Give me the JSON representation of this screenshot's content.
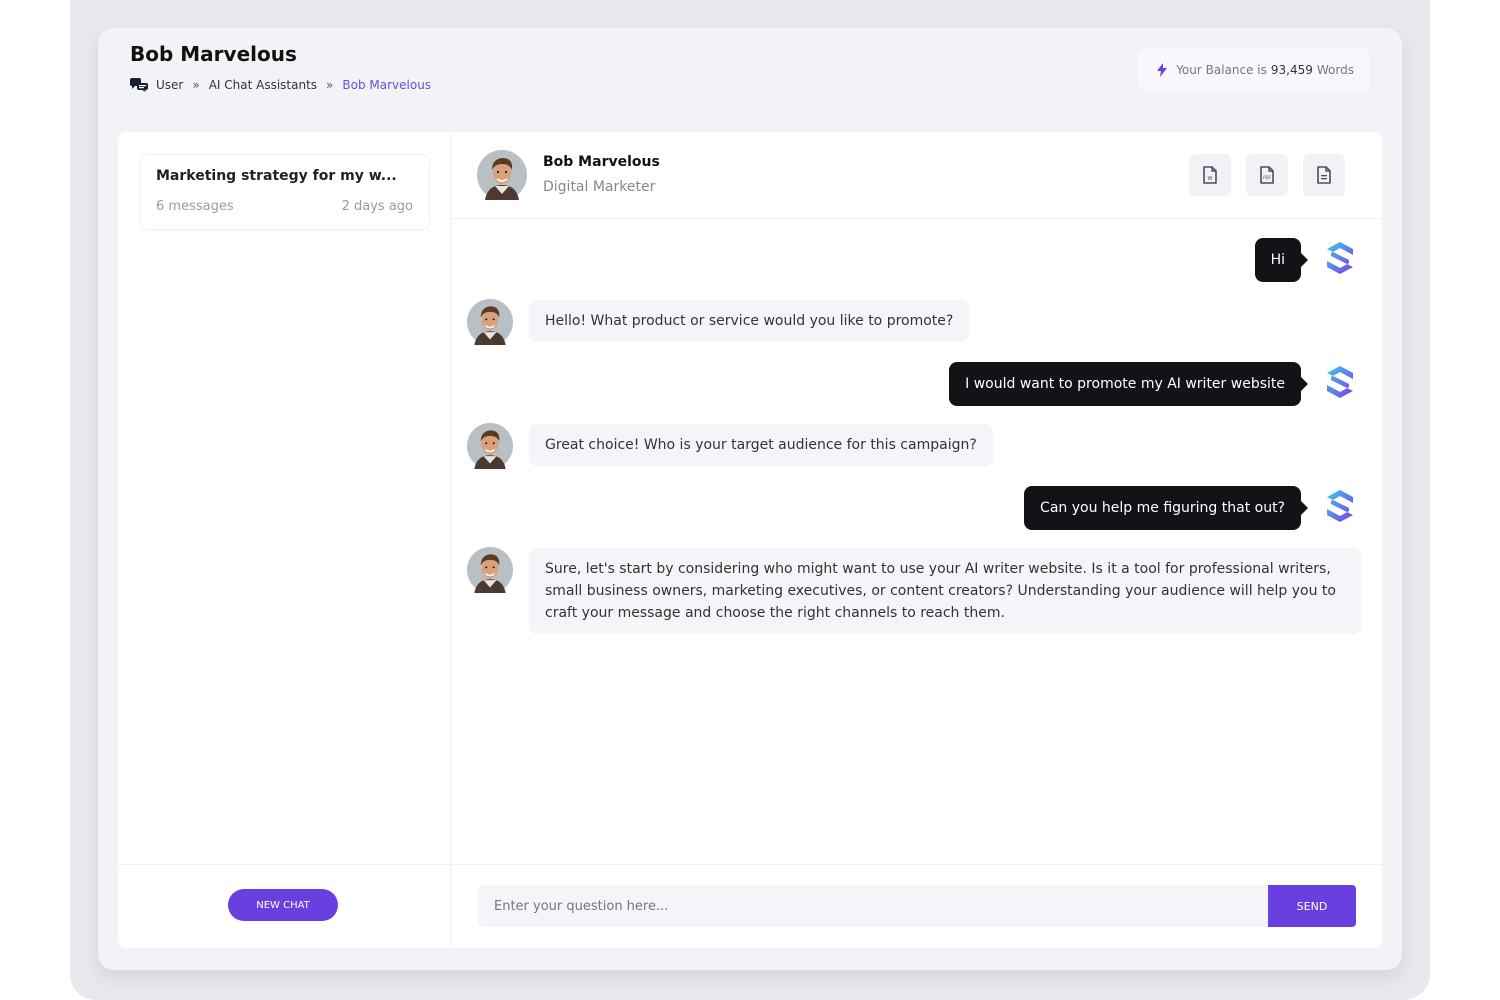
{
  "header": {
    "title": "Bob Marvelous",
    "breadcrumb": [
      "User",
      "AI Chat Assistants",
      "Bob Marvelous"
    ],
    "breadcrumb_separator": "»",
    "balance_prefix": "Your Balance is",
    "balance_value": "93,459",
    "balance_suffix": "Words"
  },
  "sidebar": {
    "conversations": [
      {
        "title": "Marketing strategy for my w...",
        "count": "6 messages",
        "time": "2 days ago"
      }
    ],
    "new_chat_label": "NEW CHAT"
  },
  "chat": {
    "assistant_name": "Bob Marvelous",
    "assistant_role": "Digital Marketer",
    "export_icons": [
      "word-doc-icon",
      "pdf-doc-icon",
      "text-doc-icon"
    ],
    "messages": [
      {
        "from": "user",
        "text": "Hi"
      },
      {
        "from": "assistant",
        "text": "Hello! What product or service would you like to promote?"
      },
      {
        "from": "user",
        "text": "I would want to promote my AI writer website"
      },
      {
        "from": "assistant",
        "text": "Great choice! Who is your target audience for this campaign?"
      },
      {
        "from": "user",
        "text": "Can you help me figuring that out?"
      },
      {
        "from": "assistant",
        "text": "Sure, let's start by considering who might want to use your AI writer website. Is it a tool for professional writers, small business owners, marketing executives, or content creators? Understanding your audience will help you to craft your message and choose the right channels to reach them."
      }
    ],
    "input_placeholder": "Enter your question here...",
    "send_label": "SEND"
  },
  "colors": {
    "accent": "#6a3fe0",
    "user_bubble": "#121316",
    "assistant_bubble": "#f4f5f8",
    "page_bg": "#f2f3f7"
  }
}
